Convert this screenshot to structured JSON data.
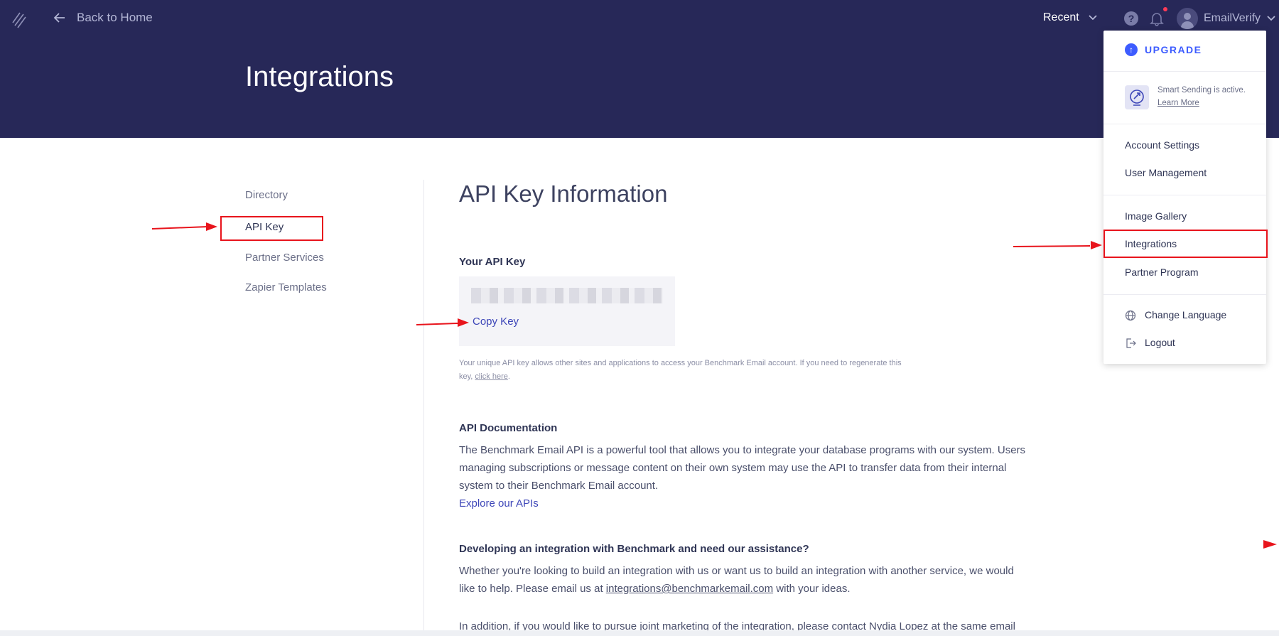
{
  "header": {
    "back_label": "Back to Home",
    "title": "Integrations",
    "recent_label": "Recent",
    "help_symbol": "?",
    "account_name": "EmailVerify"
  },
  "sidenav": {
    "items": [
      {
        "label": "Directory"
      },
      {
        "label": "API Key"
      },
      {
        "label": "Partner Services"
      },
      {
        "label": "Zapier Templates"
      }
    ]
  },
  "main": {
    "section_title": "API Key Information",
    "your_key_label": "Your API Key",
    "copy_key_label": "Copy Key",
    "key_help_prefix": "Your unique API key allows other sites and applications to access your Benchmark Email account. If you need to regenerate this key, ",
    "key_help_link": "click here",
    "key_help_suffix": ".",
    "doc_heading": "API Documentation",
    "doc_text": "The Benchmark Email API is a powerful tool that allows you to integrate your database programs with our system. Users managing subscriptions or message content on their own system may use the API to transfer data from their internal system to their Benchmark Email account.",
    "explore_link": "Explore our APIs",
    "dev_heading": "Developing an integration with Benchmark and need our assistance?",
    "dev_text_prefix": "Whether you're looking to build an integration with us or want us to build an integration with another service, we would like to help. Please email us at ",
    "dev_email": "integrations@benchmarkemail.com",
    "dev_text_suffix": " with your ideas.",
    "joint_text": "In addition, if you would like to pursue joint marketing of the integration, please contact Nydia Lopez at the same email"
  },
  "dropdown": {
    "upgrade_label": "UPGRADE",
    "smart_sending": "Smart Sending is active.",
    "learn_more": "Learn More",
    "items_group1": [
      "Account Settings",
      "User Management"
    ],
    "items_group2": [
      "Image Gallery",
      "Integrations",
      "Partner Program"
    ],
    "change_language": "Change Language",
    "logout": "Logout"
  },
  "colors": {
    "header_bg": "#272858",
    "accent": "#3d5cff",
    "link": "#3d46b8",
    "highlight": "#e8141c"
  }
}
